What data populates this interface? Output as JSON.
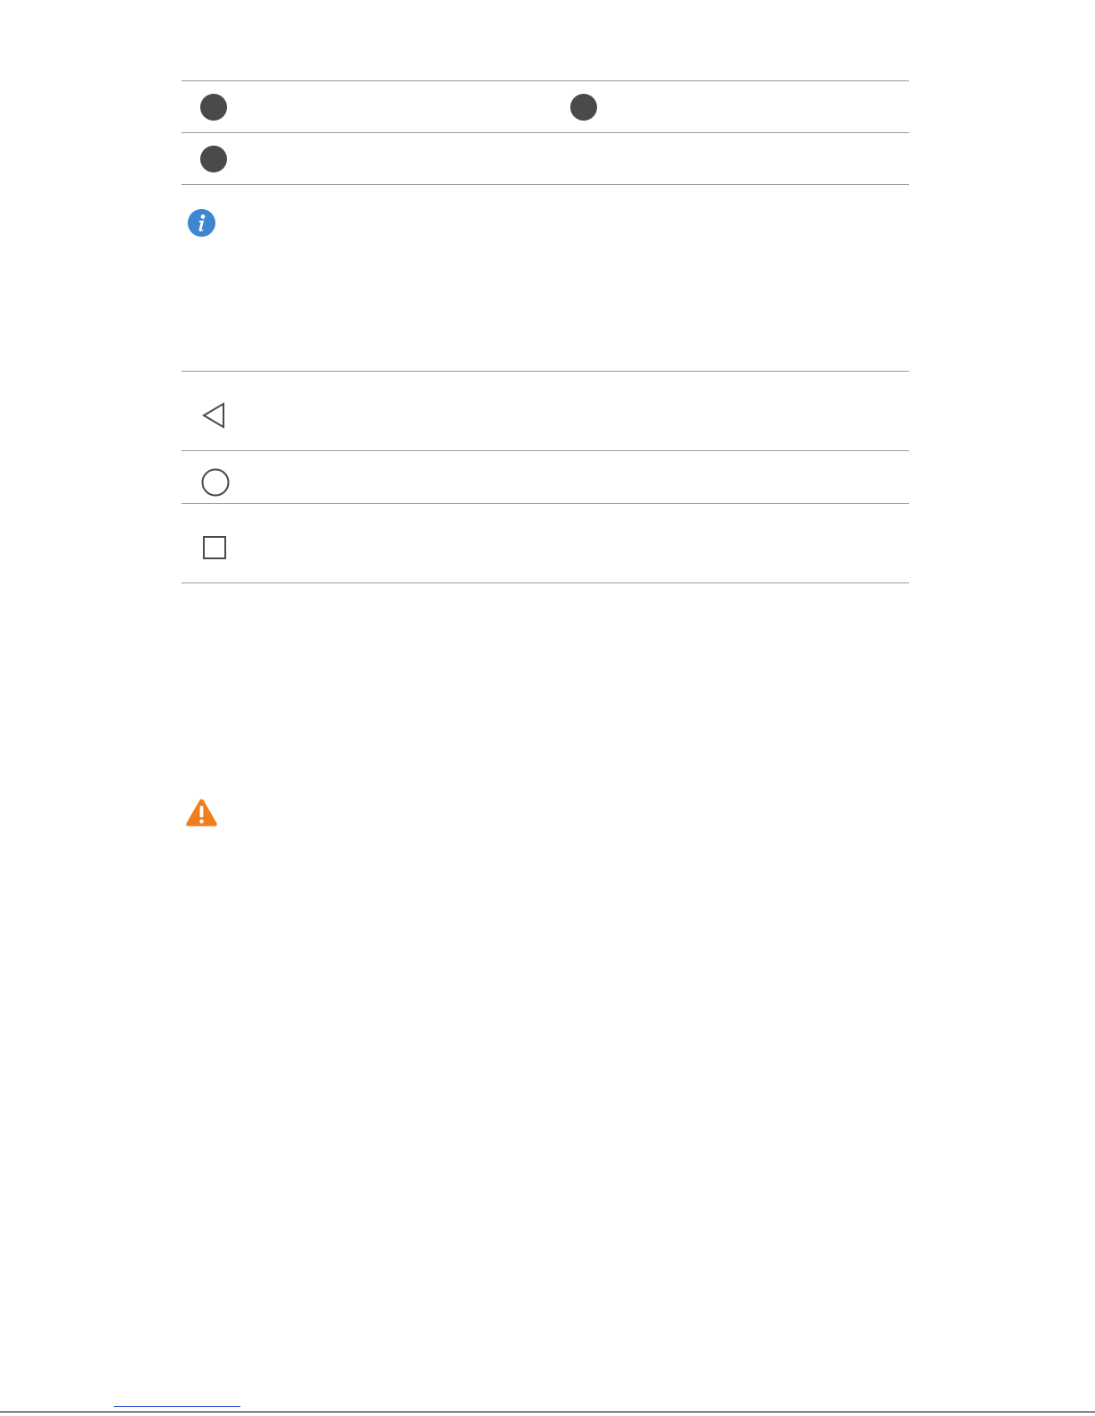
{
  "colors": {
    "info_icon": "#3f86d1",
    "warning_icon": "#f07e1c",
    "bullet": "#4a4a4a",
    "rule": "#9a9a9a",
    "link_underline": "#1a3cc8"
  },
  "icons": {
    "info": "info-icon",
    "warning": "warning-icon",
    "back": "back-icon",
    "home": "home-icon",
    "recent": "recent-apps-icon"
  }
}
